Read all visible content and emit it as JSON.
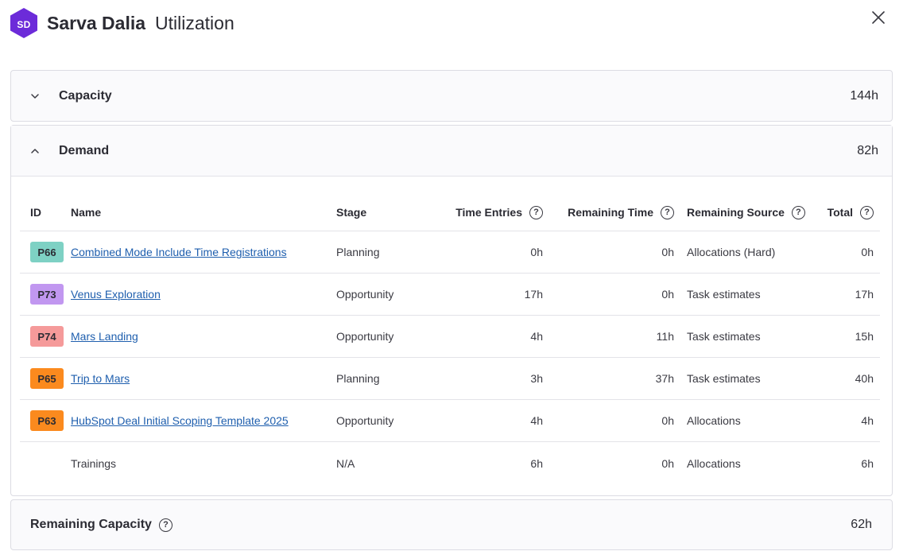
{
  "header": {
    "avatar_initials": "SD",
    "avatar_color": "#6c2bd9",
    "person_name": "Sarva Dalia",
    "title_suffix": "Utilization"
  },
  "capacity": {
    "label": "Capacity",
    "value": "144h",
    "expanded": false
  },
  "demand": {
    "label": "Demand",
    "value": "82h",
    "expanded": true,
    "columns": {
      "id": "ID",
      "name": "Name",
      "stage": "Stage",
      "time_entries": "Time Entries",
      "remaining_time": "Remaining Time",
      "remaining_source": "Remaining Source",
      "total": "Total"
    },
    "rows": [
      {
        "id": "P66",
        "badge_color": "#7ed1c4",
        "name": "Combined Mode Include Time Registrations",
        "stage": "Planning",
        "time_entries": "0h",
        "remaining_time": "0h",
        "remaining_source": "Allocations (Hard)",
        "total": "0h"
      },
      {
        "id": "P73",
        "badge_color": "#c197f0",
        "name": "Venus Exploration",
        "stage": "Opportunity",
        "time_entries": "17h",
        "remaining_time": "0h",
        "remaining_source": "Task estimates",
        "total": "17h"
      },
      {
        "id": "P74",
        "badge_color": "#f59a9a",
        "name": "Mars Landing",
        "stage": "Opportunity",
        "time_entries": "4h",
        "remaining_time": "11h",
        "remaining_source": "Task estimates",
        "total": "15h"
      },
      {
        "id": "P65",
        "badge_color": "#fb8a1e",
        "name": "Trip to Mars",
        "stage": "Planning",
        "time_entries": "3h",
        "remaining_time": "37h",
        "remaining_source": "Task estimates",
        "total": "40h"
      },
      {
        "id": "P63",
        "badge_color": "#fb8a1e",
        "name": "HubSpot Deal Initial Scoping Template 2025",
        "stage": "Opportunity",
        "time_entries": "4h",
        "remaining_time": "0h",
        "remaining_source": "Allocations",
        "total": "4h"
      },
      {
        "id": "",
        "badge_color": "",
        "name": "Trainings",
        "stage": "N/A",
        "time_entries": "6h",
        "remaining_time": "0h",
        "remaining_source": "Allocations",
        "total": "6h"
      }
    ]
  },
  "remaining_capacity": {
    "label": "Remaining Capacity",
    "value": "62h"
  },
  "icons": {
    "help_glyph": "?"
  }
}
